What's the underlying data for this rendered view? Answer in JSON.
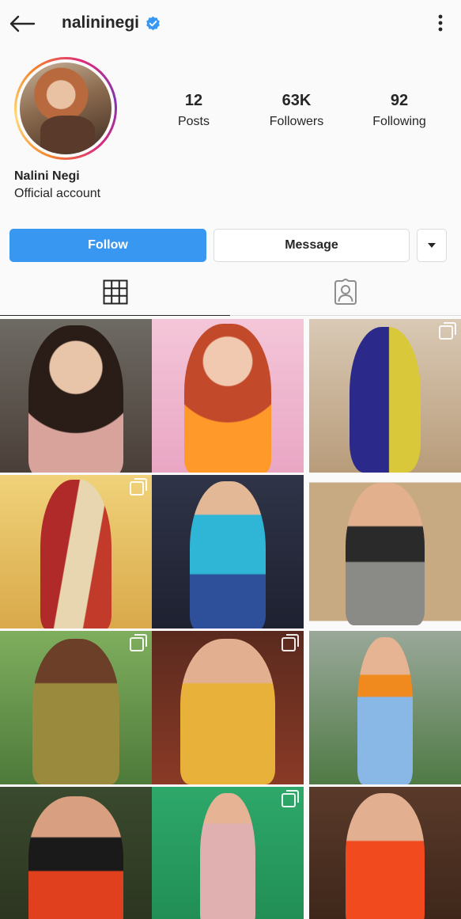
{
  "header": {
    "username": "nalininegi",
    "back_icon": "arrow-left-icon",
    "verified_icon": "verified-badge-icon",
    "more_icon": "vertical-dots-icon"
  },
  "profile": {
    "display_name": "Nalini Negi",
    "category": "Official account",
    "stats": [
      {
        "value": "12",
        "label": "Posts"
      },
      {
        "value": "63K",
        "label": "Followers"
      },
      {
        "value": "92",
        "label": "Following"
      }
    ]
  },
  "actions": {
    "follow_label": "Follow",
    "message_label": "Message",
    "dropdown_icon": "caret-down-icon"
  },
  "tabs": [
    {
      "name": "grid",
      "icon": "grid-icon",
      "active": true
    },
    {
      "name": "tagged",
      "icon": "tagged-person-icon",
      "active": false
    }
  ],
  "colors": {
    "accent": "#3897f0",
    "text": "#262626",
    "border": "#dbdbdb",
    "background": "#fafafa"
  },
  "posts": [
    {
      "multi": false
    },
    {
      "multi": false
    },
    {
      "multi": true
    },
    {
      "multi": true
    },
    {
      "multi": false
    },
    {
      "multi": false
    },
    {
      "multi": true
    },
    {
      "multi": true
    },
    {
      "multi": false
    },
    {
      "multi": false
    },
    {
      "multi": true
    },
    {
      "multi": false
    }
  ]
}
